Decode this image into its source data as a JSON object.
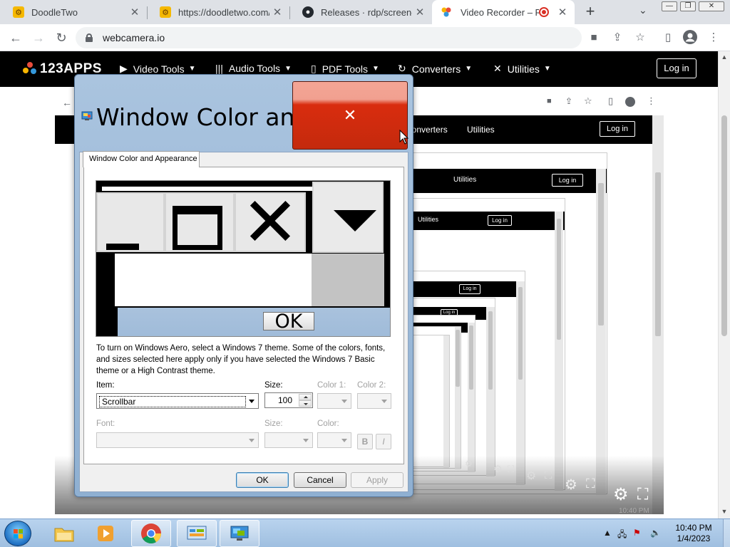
{
  "browser": {
    "tabs": [
      {
        "title": "DoodleTwo",
        "active": false
      },
      {
        "title": "https://doodletwo.com/b",
        "active": false
      },
      {
        "title": "Releases · rdp/screen-cap",
        "active": false
      },
      {
        "title": "Video Recorder – Re",
        "active": true,
        "recording": true
      }
    ],
    "address": "webcamera.io"
  },
  "site": {
    "logo": "123APPS",
    "nav": [
      "Video Tools",
      "Audio Tools",
      "PDF Tools",
      "Converters",
      "Utilities"
    ],
    "login": "Log in",
    "recursive_nav": [
      "Converters",
      "Utilities"
    ],
    "recursive_login": "Log in"
  },
  "dialog": {
    "title": "Window Color an...",
    "tab": "Window Color and Appearance",
    "preview_ok": "OK",
    "info": "To turn on Windows Aero, select a Windows 7 theme.  Some of the colors, fonts, and sizes selected here apply only if you have selected the Windows 7 Basic theme or a High Contrast theme.",
    "item_label": "Item:",
    "item_value": "Scrollbar",
    "size_label": "Size:",
    "size_value": "100",
    "color1_label": "Color 1:",
    "color2_label": "Color 2:",
    "font_label": "Font:",
    "font_size_label": "Size:",
    "font_color_label": "Color:",
    "bold": "B",
    "italic": "I",
    "ok": "OK",
    "cancel": "Cancel",
    "apply": "Apply"
  },
  "taskbar": {
    "time": "10:40 PM",
    "date": "1/4/2023",
    "apps": [
      "windows-explorer",
      "media-player",
      "chrome",
      "control-panel",
      "display-settings"
    ]
  },
  "colors": {
    "close_button": "#d62c0e",
    "title_bar": "#a9c4e0",
    "taskbar": "#b3cfec",
    "site_nav": "#000000"
  }
}
